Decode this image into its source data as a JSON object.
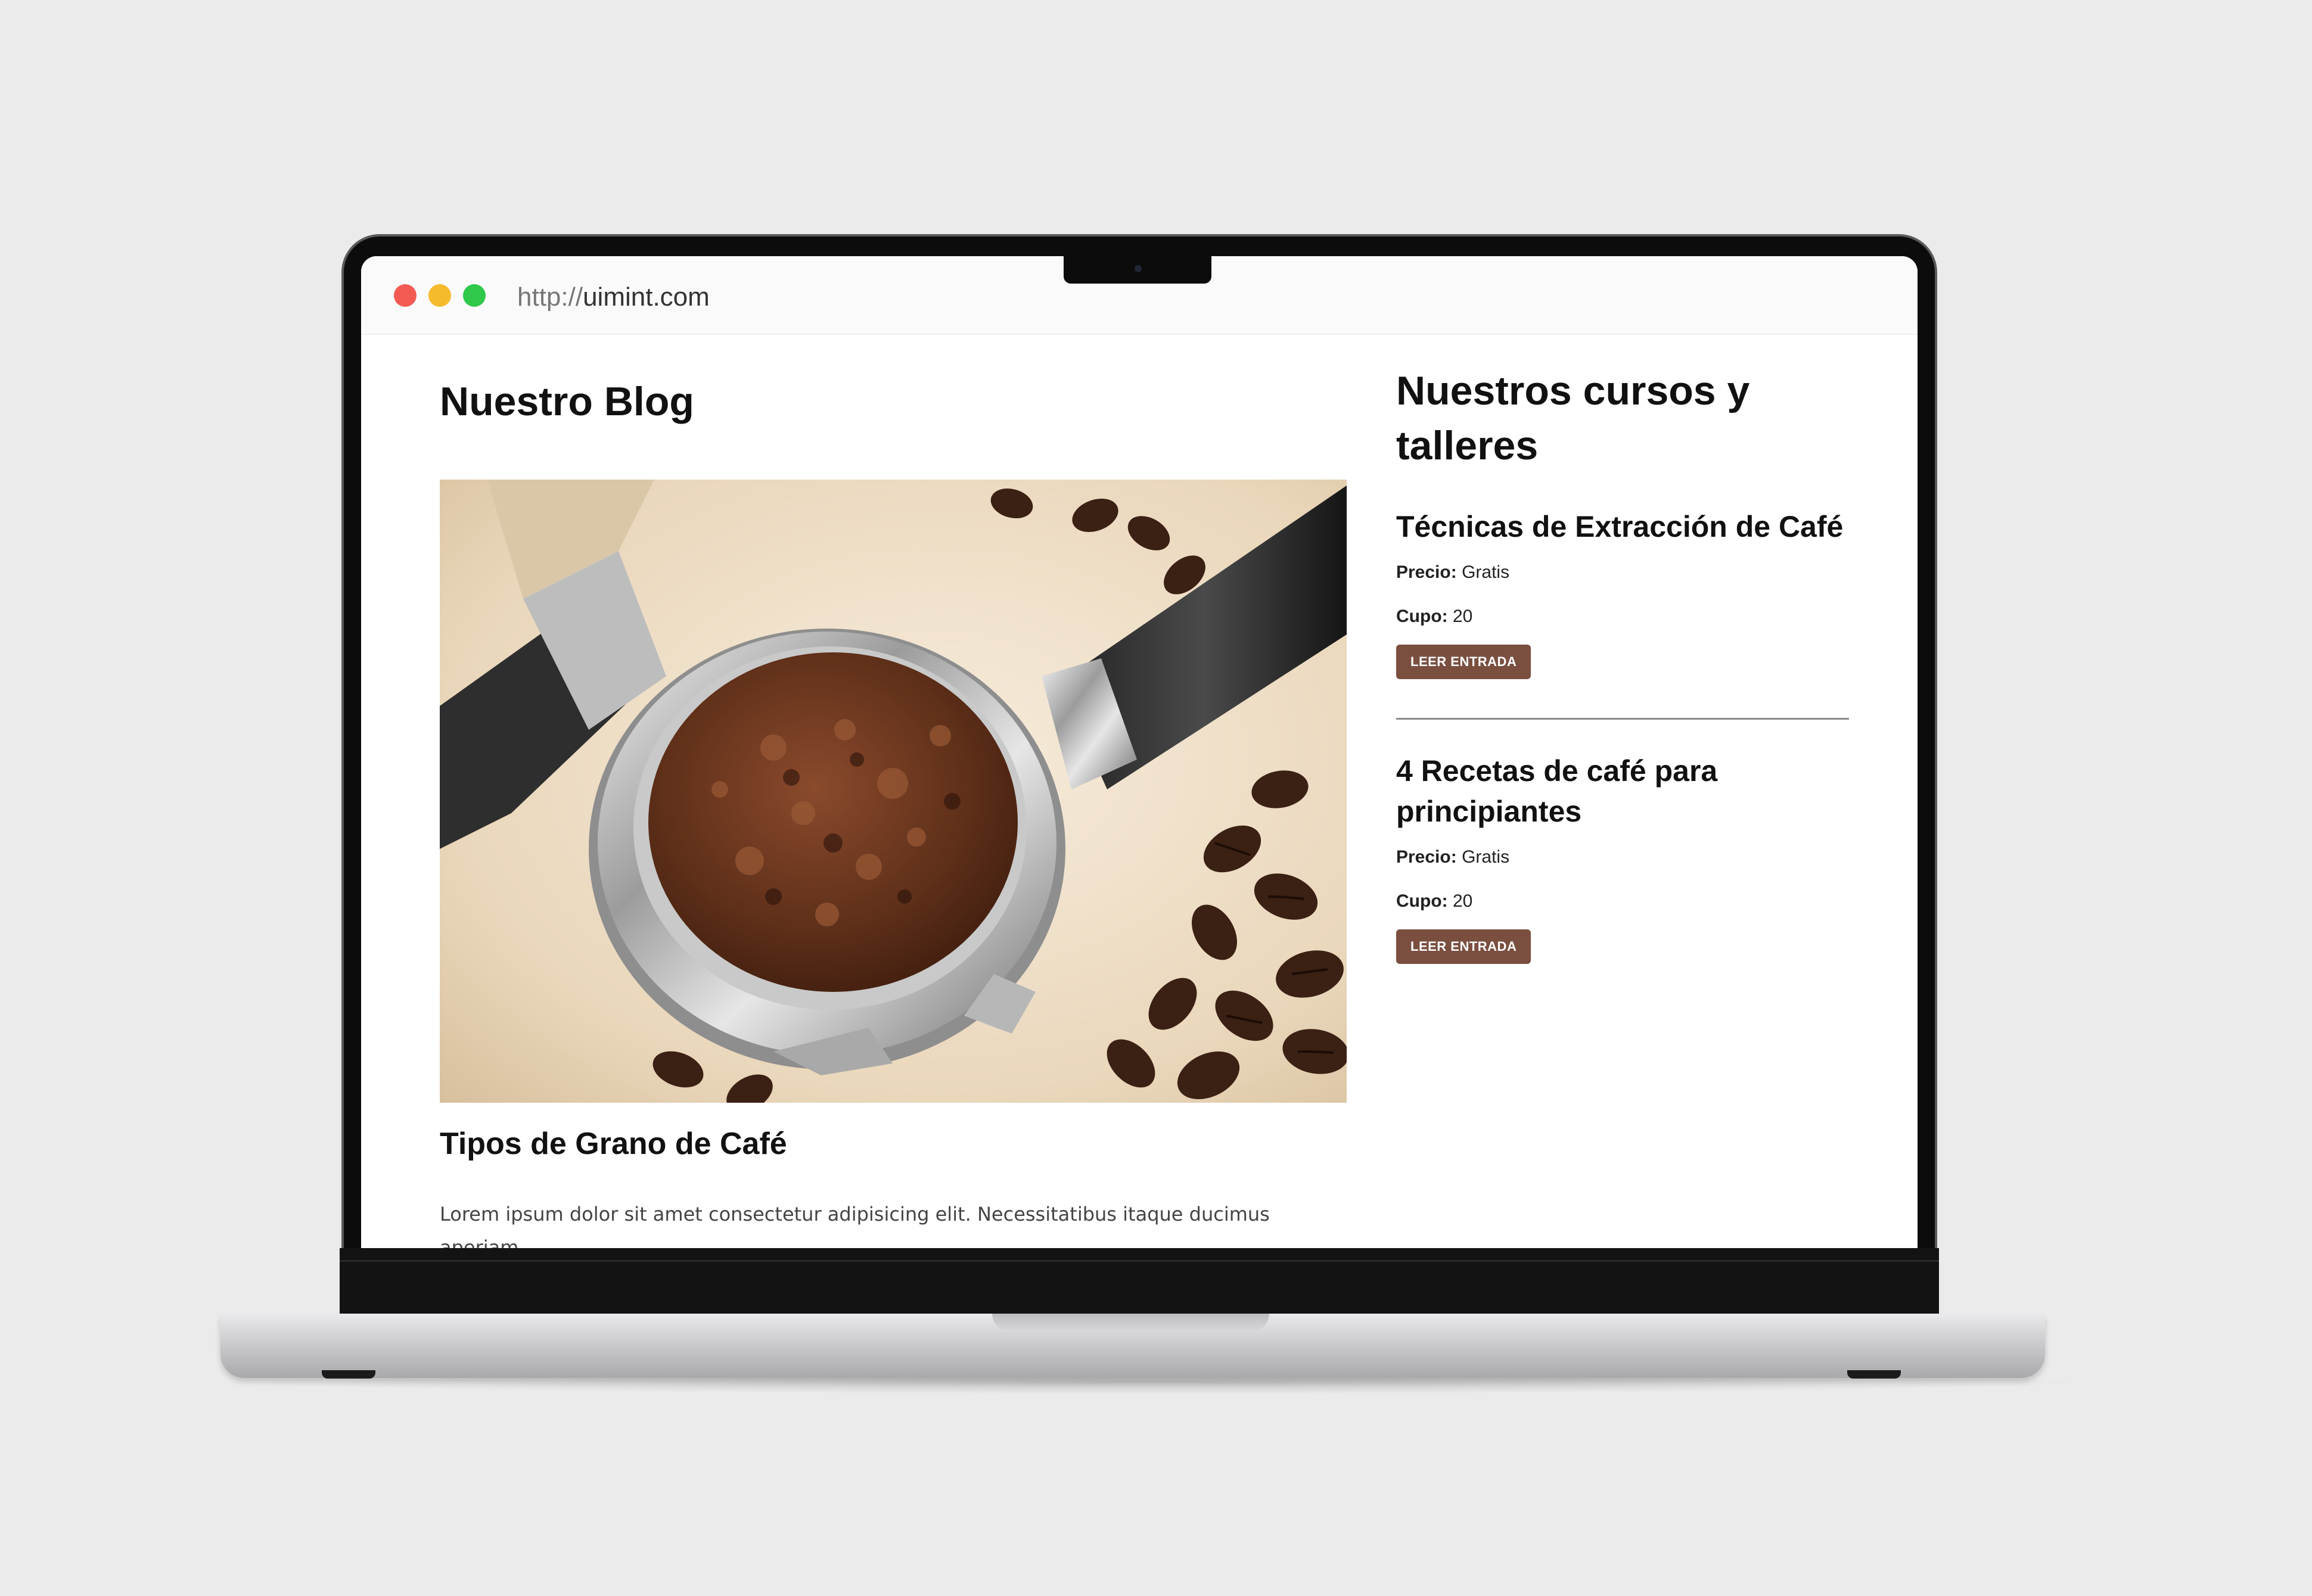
{
  "browser": {
    "url_protocol": "http://",
    "url_host": "uimint.com"
  },
  "blog": {
    "title": "Nuestro Blog",
    "post": {
      "title": "Tipos de Grano de Café",
      "excerpt": "Lorem ipsum dolor sit amet consectetur adipisicing elit. Necessitatibus itaque ducimus aperiam"
    }
  },
  "sidebar": {
    "title": "Nuestros cursos y talleres",
    "courses": [
      {
        "title": "Técnicas de Extracción de Café",
        "price_label": "Precio:",
        "price": "Gratis",
        "seats_label": "Cupo:",
        "seats": "20",
        "button": "Leer Entrada"
      },
      {
        "title": "4 Recetas de café para principiantes",
        "price_label": "Precio:",
        "price": "Gratis",
        "seats_label": "Cupo:",
        "seats": "20",
        "button": "Leer Entrada"
      }
    ]
  },
  "colors": {
    "button": "#7b4f40",
    "page_background": "#ebebeb",
    "traffic_red": "#f25a52",
    "traffic_yellow": "#f6bb2c",
    "traffic_green": "#2fc84b"
  }
}
